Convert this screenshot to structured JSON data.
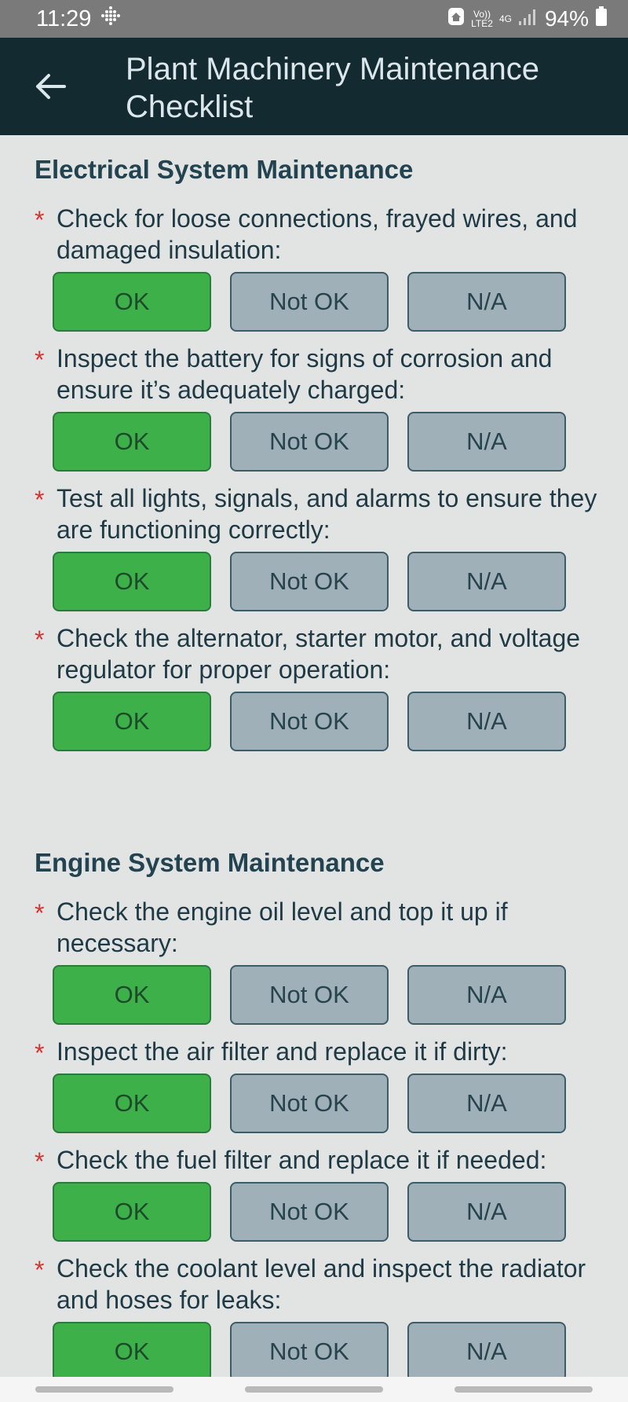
{
  "status": {
    "time": "11:29",
    "volte": "Vo))",
    "lte": "LTE2",
    "network": "4G",
    "battery": "94%"
  },
  "header": {
    "title": "Plant Machinery Maintenance Checklist"
  },
  "options": {
    "ok": "OK",
    "not_ok": "Not OK",
    "na": "N/A"
  },
  "sections": [
    {
      "title": "Electrical System Maintenance",
      "questions": [
        {
          "text": " Check for loose connections, frayed wires, and damaged insulation:",
          "selected": "OK"
        },
        {
          "text": " Inspect the battery for signs of corrosion and ensure it’s adequately charged:",
          "selected": "OK"
        },
        {
          "text": "Test all lights, signals, and alarms to ensure they are functioning correctly:",
          "selected": "OK"
        },
        {
          "text": "Check the alternator, starter motor, and voltage regulator for proper operation:",
          "selected": "OK"
        }
      ]
    },
    {
      "title": "Engine System Maintenance",
      "questions": [
        {
          "text": " Check the engine oil level and top it up if necessary:",
          "selected": "OK"
        },
        {
          "text": " Inspect the air filter and replace it if dirty:",
          "selected": "OK"
        },
        {
          "text": "Check the fuel filter and replace it if needed:",
          "selected": "OK"
        },
        {
          "text": "Check the coolant level and inspect the radiator and hoses for leaks:",
          "selected": "OK"
        }
      ]
    }
  ],
  "colors": {
    "selected": "#3eb049",
    "unselected": "#9fb0b8",
    "header": "#142a31",
    "required_star": "#d8322f"
  }
}
